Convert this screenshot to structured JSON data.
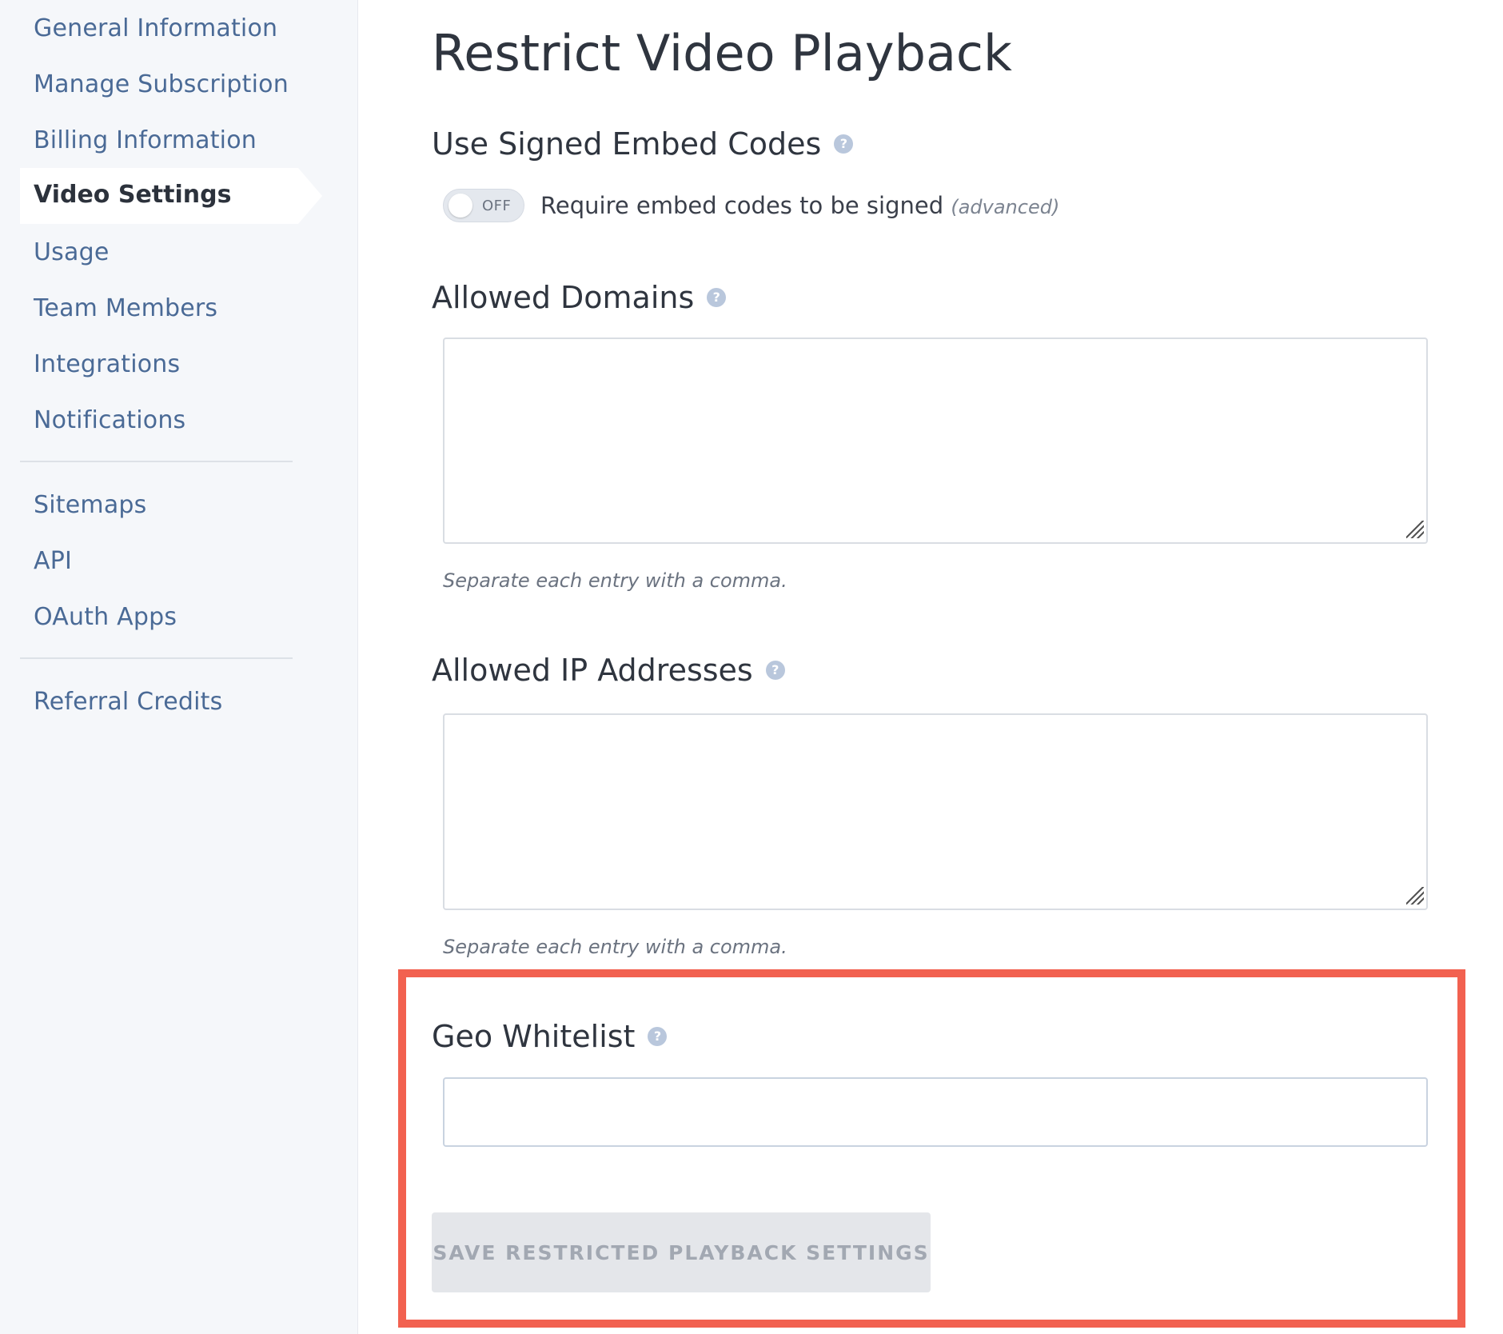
{
  "sidebar": {
    "items": [
      {
        "label": "General Information"
      },
      {
        "label": "Manage Subscription"
      },
      {
        "label": "Billing Information"
      },
      {
        "label": "Video Settings",
        "active": true
      },
      {
        "label": "Usage"
      },
      {
        "label": "Team Members"
      },
      {
        "label": "Integrations"
      },
      {
        "label": "Notifications"
      },
      {
        "label": "Sitemaps"
      },
      {
        "label": "API"
      },
      {
        "label": "OAuth Apps"
      },
      {
        "label": "Referral Credits"
      }
    ]
  },
  "main": {
    "title": "Restrict Video Playback",
    "signed_embed": {
      "title": "Use Signed Embed Codes",
      "toggle_state": "OFF",
      "description": "Require embed codes to be signed",
      "note": "(advanced)"
    },
    "allowed_domains": {
      "title": "Allowed Domains",
      "value": "",
      "hint": "Separate each entry with a comma."
    },
    "allowed_ips": {
      "title": "Allowed IP Addresses",
      "value": "",
      "hint": "Separate each entry with a comma."
    },
    "geo_whitelist": {
      "title": "Geo Whitelist",
      "value": ""
    },
    "save_label": "SAVE RESTRICTED PLAYBACK SETTINGS",
    "help_glyph": "?"
  },
  "colors": {
    "accent_link": "#4a6a96",
    "highlight": "#f26150",
    "sidebar_bg": "#f5f7fa"
  }
}
